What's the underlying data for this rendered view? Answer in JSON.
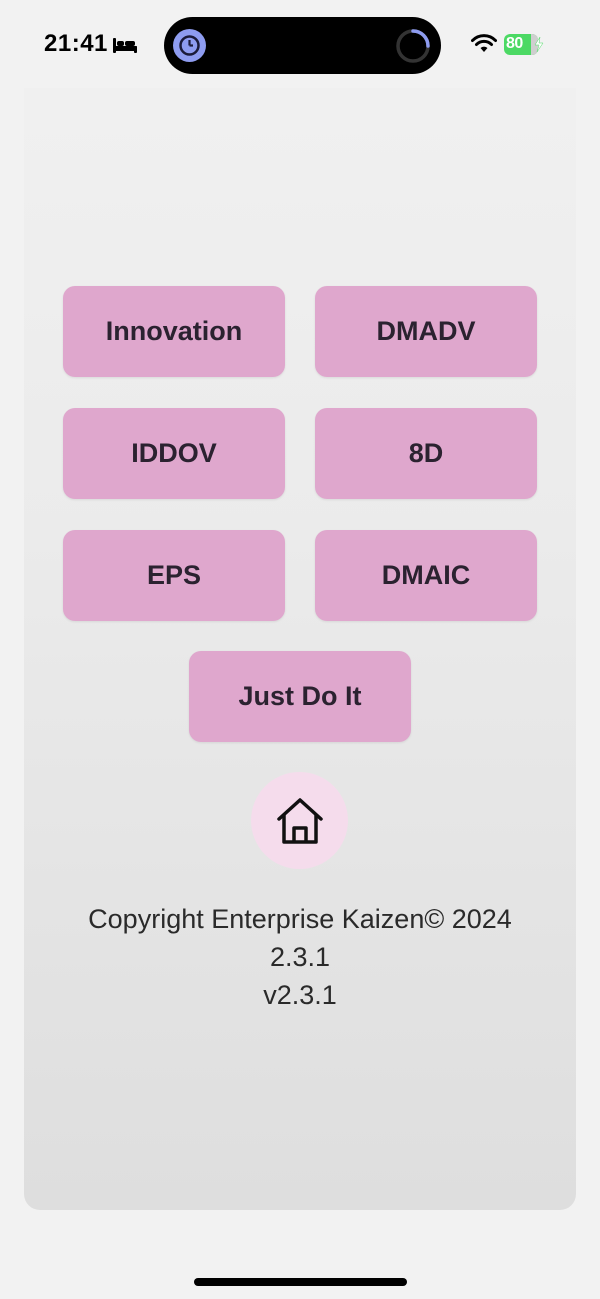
{
  "status_bar": {
    "time": "21:41",
    "battery_level": "80",
    "icons": [
      "bed-icon",
      "timer-icon",
      "activity-ring-icon",
      "wifi-icon",
      "battery-icon",
      "charging-bolt-icon"
    ],
    "battery_color": "#4cd964"
  },
  "menu": {
    "buttons": [
      {
        "label": "Innovation"
      },
      {
        "label": "DMADV"
      },
      {
        "label": "IDDOV"
      },
      {
        "label": "8D"
      },
      {
        "label": "EPS"
      },
      {
        "label": "DMAIC"
      },
      {
        "label": "Just Do It"
      }
    ],
    "button_color": "#dfa7cd",
    "home_button_color": "#f5dcec",
    "home_icon": "home-icon"
  },
  "footer": {
    "copyright": "Copyright Enterprise Kaizen© 2024",
    "version_number": "2.3.1",
    "version_label": "v2.3.1"
  }
}
